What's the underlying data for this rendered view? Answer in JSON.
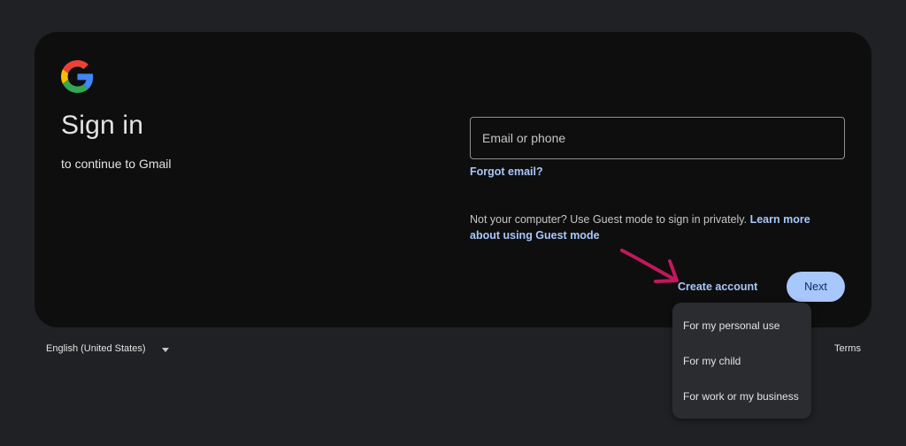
{
  "brand": {
    "logo_icon": "google-g-icon"
  },
  "header": {
    "title": "Sign in",
    "subtitle": "to continue to Gmail"
  },
  "form": {
    "email_placeholder": "Email or phone",
    "email_value": "",
    "forgot_email": "Forgot email?",
    "guest_text": "Not your computer? Use Guest mode to sign in privately.",
    "guest_link": "Learn more about using Guest mode",
    "create_account": "Create account",
    "next": "Next"
  },
  "create_menu": {
    "items": [
      "For my personal use",
      "For my child",
      "For work or my business"
    ]
  },
  "footer": {
    "language": "English (United States)",
    "terms": "Terms"
  },
  "colors": {
    "background": "#202124",
    "card": "#0e0e0e",
    "link": "#a8c7fa",
    "primary_button": "#a8c7fa",
    "annotation_arrow": "#c2185b"
  }
}
